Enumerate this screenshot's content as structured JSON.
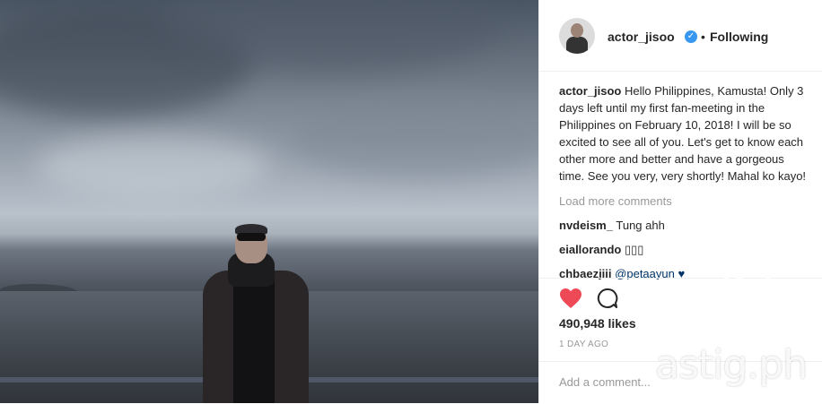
{
  "post": {
    "username": "actor_jisoo",
    "follow_separator": "•",
    "follow_status": "Following",
    "caption": "Hello Philippines, Kamusta! Only 3 days left until my first fan-meeting in the Philippines on February 10, 2018! I will be so excited to see all of you. Let's get to know each other more and better and have a gorgeous time. See you very, very shortly! Mahal ko kayo!",
    "load_more_label": "Load more comments",
    "comments": [
      {
        "user": "nvdeism_",
        "text": "Tung ahh"
      },
      {
        "user": "eiallorando",
        "text": "▯▯▯"
      },
      {
        "user": "chbaezjiii",
        "text": "@petaayun ♥"
      }
    ],
    "likes": "490,948 likes",
    "timestamp": "1 DAY AGO",
    "add_comment_placeholder": "Add a comment..."
  },
  "watermark": {
    "text": "astig.ph"
  },
  "icons": {
    "like": "heart-icon",
    "comment": "comment-bubble-icon",
    "verified": "verified-badge-icon"
  },
  "colors": {
    "like": "#ed4956",
    "verified": "#3897f0",
    "muted": "#999999",
    "text": "#262626"
  }
}
